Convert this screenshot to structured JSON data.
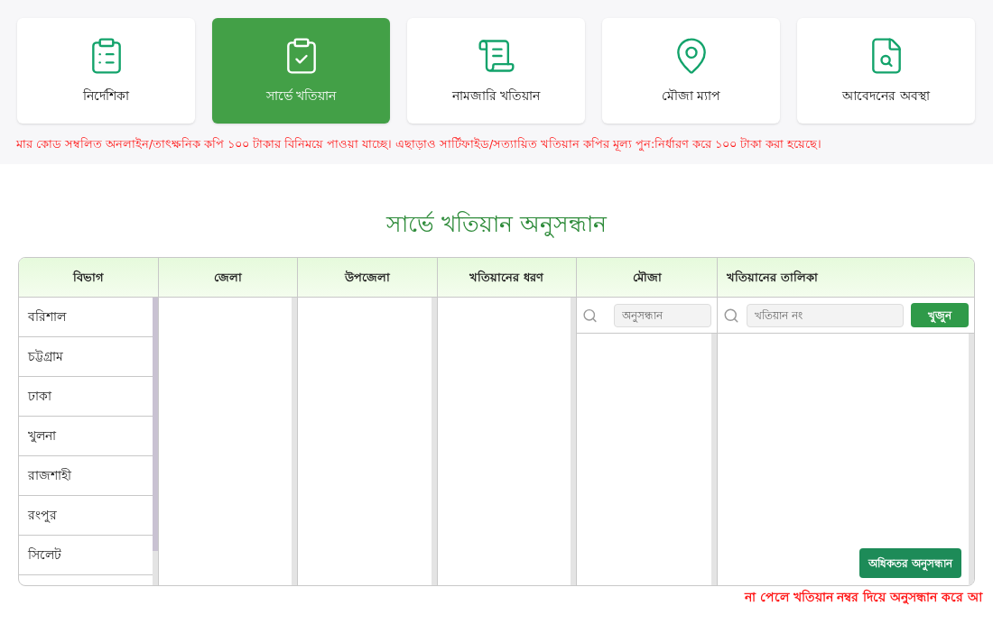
{
  "nav_cards": [
    {
      "label": "নির্দেশিকা",
      "selected": false
    },
    {
      "label": "সার্ভে খতিয়ান",
      "selected": true
    },
    {
      "label": "নামজারি খতিয়ান",
      "selected": false
    },
    {
      "label": "মৌজা ম্যাপ",
      "selected": false
    },
    {
      "label": "আবেদনের অবস্থা",
      "selected": false
    }
  ],
  "notice": "মার কোড সম্বলিত অনলাইন/তাৎক্ষনিক কপি ১০০ টাকার বিনিময়ে পাওয়া যাচ্ছে। এছাড়াও সার্টিফাইড/সত্যায়িত খতিয়ান কপির মূল্য পুন:নির্ধারণ করে ১০০ টাকা করা হয়েছে।",
  "title": "সার্ভে খতিয়ান অনুসন্ধান",
  "columns": [
    {
      "heading": "বিভাগ",
      "items": [
        "বরিশাল",
        "চট্টগ্রাম",
        "ঢাকা",
        "খুলনা",
        "রাজশাহী",
        "রংপুর",
        "সিলেট"
      ]
    },
    {
      "heading": "জেলা"
    },
    {
      "heading": "উপজেলা"
    },
    {
      "heading": "খতিয়ানের ধরণ"
    },
    {
      "heading": "মৌজা",
      "search": {
        "placeholder": "অনুসন্ধান"
      }
    }
  ],
  "khatian_list": {
    "heading": "খতিয়ানের তালিকা",
    "search": {
      "placeholder": "খতিয়ান নং"
    },
    "find_button": "খুজুন",
    "advanced_button": "অধিকতর অনুসন্ধান"
  },
  "footer_notice": "না পেলে খতিয়ান নম্বর দিয়ে অনুসন্ধান করে আ"
}
